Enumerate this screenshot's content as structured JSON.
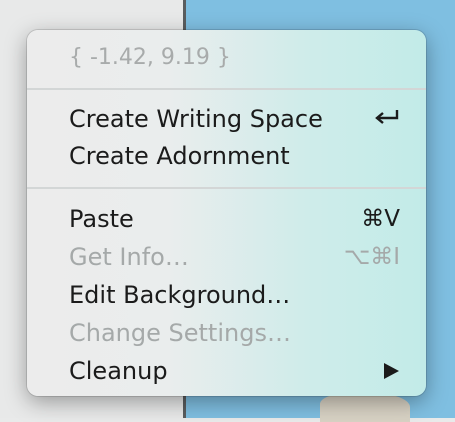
{
  "menu": {
    "coordinates": "{ -1.42, 9.19 }",
    "items": [
      {
        "label": "Create Writing Space",
        "shortcut_icon": "return-icon"
      },
      {
        "label": "Create Adornment"
      },
      {
        "label": "Paste",
        "shortcut": "⌘V"
      },
      {
        "label": "Get Info…",
        "shortcut": "⌥⌘I",
        "disabled": true
      },
      {
        "label": "Edit Background…"
      },
      {
        "label": "Change Settings…",
        "disabled": true
      },
      {
        "label": "Cleanup",
        "submenu_icon": "triangle-right-icon"
      }
    ]
  }
}
